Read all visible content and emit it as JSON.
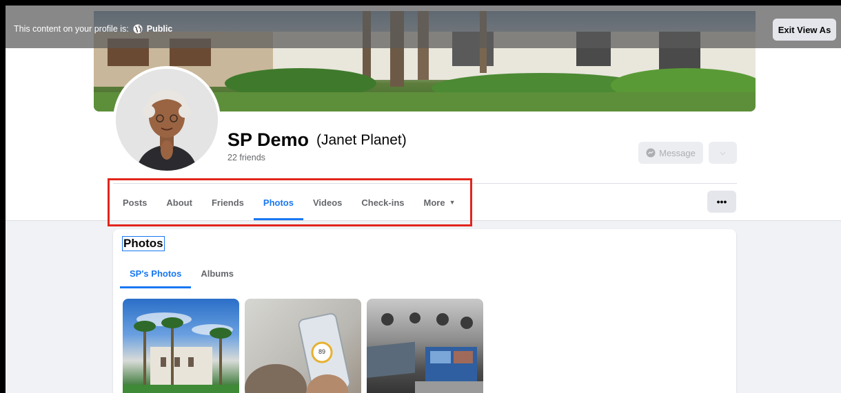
{
  "banner": {
    "text": "This content on your profile is:",
    "visibility": "Public",
    "exit_label": "Exit View As"
  },
  "profile": {
    "name": "SP Demo",
    "alternate_name": "(Janet Planet)",
    "friends": "22 friends"
  },
  "actions": {
    "message_label": "Message",
    "more_options_label": "•••"
  },
  "tabs": [
    {
      "label": "Posts",
      "active": false
    },
    {
      "label": "About",
      "active": false
    },
    {
      "label": "Friends",
      "active": false
    },
    {
      "label": "Photos",
      "active": true
    },
    {
      "label": "Videos",
      "active": false
    },
    {
      "label": "Check-ins",
      "active": false
    },
    {
      "label": "More",
      "active": false
    }
  ],
  "photos_section": {
    "title": "Photos",
    "sub_tabs": [
      {
        "label": "SP's Photos",
        "active": true
      },
      {
        "label": "Albums",
        "active": false
      }
    ],
    "phone_reading": "89"
  },
  "colors": {
    "accent": "#1877f2",
    "highlight_box": "#e1251b",
    "page_bg": "#f0f2f5"
  }
}
